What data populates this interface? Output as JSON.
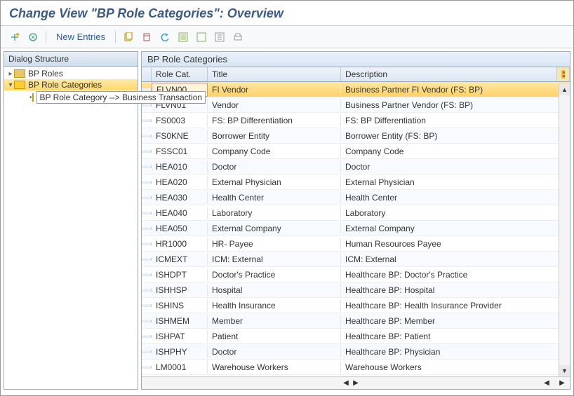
{
  "window_title": "Change View \"BP Role Categories\": Overview",
  "toolbar": {
    "new_entries": "New Entries"
  },
  "tree": {
    "header": "Dialog Structure",
    "bp_roles": "BP Roles",
    "bp_role_categories": "BP Role Categories",
    "bp_role_category_bt": "BP Role Category --> Business Transaction"
  },
  "grid": {
    "section_title": "BP Role Categories",
    "col_role": "Role Cat.",
    "col_title": "Title",
    "col_desc": "Description",
    "rows": [
      {
        "code": "FLVN00",
        "title": "FI Vendor",
        "desc": "Business Partner FI Vendor (FS: BP)"
      },
      {
        "code": "FLVN01",
        "title": "Vendor",
        "desc": "Business Partner Vendor (FS: BP)"
      },
      {
        "code": "FS0003",
        "title": "FS: BP Differentiation",
        "desc": "FS: BP Differentiation"
      },
      {
        "code": "FS0KNE",
        "title": "Borrower Entity",
        "desc": "Borrower Entity (FS: BP)"
      },
      {
        "code": "FSSC01",
        "title": "Company Code",
        "desc": "Company Code"
      },
      {
        "code": "HEA010",
        "title": "Doctor",
        "desc": "Doctor"
      },
      {
        "code": "HEA020",
        "title": "External Physician",
        "desc": "External Physician"
      },
      {
        "code": "HEA030",
        "title": "Health Center",
        "desc": "Health Center"
      },
      {
        "code": "HEA040",
        "title": "Laboratory",
        "desc": "Laboratory"
      },
      {
        "code": "HEA050",
        "title": "External Company",
        "desc": "External Company"
      },
      {
        "code": "HR1000",
        "title": "HR- Payee",
        "desc": "Human Resources Payee"
      },
      {
        "code": "ICMEXT",
        "title": "ICM: External",
        "desc": "ICM: External"
      },
      {
        "code": "ISHDPT",
        "title": "Doctor's Practice",
        "desc": "Healthcare BP: Doctor's Practice"
      },
      {
        "code": "ISHHSP",
        "title": "Hospital",
        "desc": "Healthcare BP: Hospital"
      },
      {
        "code": "ISHINS",
        "title": "Health Insurance",
        "desc": "Healthcare BP: Health Insurance Provider"
      },
      {
        "code": "ISHMEM",
        "title": "Member",
        "desc": "Healthcare BP: Member"
      },
      {
        "code": "ISHPAT",
        "title": "Patient",
        "desc": "Healthcare BP: Patient"
      },
      {
        "code": "ISHPHY",
        "title": "Doctor",
        "desc": "Healthcare BP: Physician"
      },
      {
        "code": "LM0001",
        "title": "Warehouse Workers",
        "desc": "Warehouse Workers"
      }
    ]
  }
}
